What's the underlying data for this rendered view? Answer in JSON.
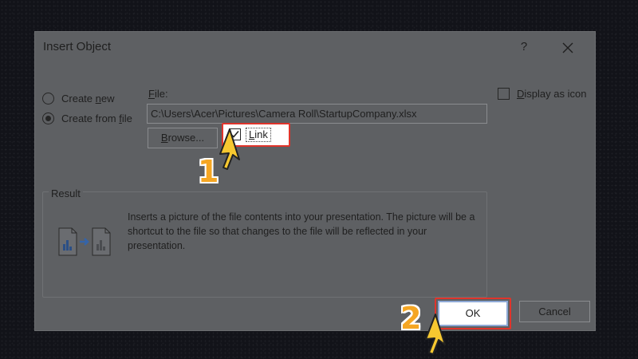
{
  "dialog": {
    "title": "Insert Object",
    "help_label": "?",
    "close_icon": "close-icon"
  },
  "options": {
    "create_new": {
      "accel": "Create ",
      "u": "n",
      "rest": "ew"
    },
    "create_from_file": {
      "accel": "Create from ",
      "u": "f",
      "rest": "ile"
    },
    "selected": "create_from_file"
  },
  "file": {
    "label_u": "F",
    "label_rest": "ile:",
    "path": "C:\\Users\\Acer\\Pictures\\Camera Roll\\StartupCompany.xlsx",
    "browse_u": "B",
    "browse_rest": "rowse...",
    "link_u": "L",
    "link_rest": "ink",
    "link_checked": true
  },
  "display_as_icon": {
    "u": "D",
    "rest": "isplay as icon",
    "checked": false
  },
  "result": {
    "title": "Result",
    "text": "Inserts a picture of the file contents into your presentation. The picture will be a shortcut to the file so that changes to the file will be reflected in your presentation.",
    "icon": "linked-file-icon"
  },
  "buttons": {
    "ok": "OK",
    "cancel": "Cancel"
  },
  "annotations": {
    "step1": "1",
    "step2": "2",
    "highlight_color": "#e0342b",
    "number_color": "#f5a623"
  }
}
